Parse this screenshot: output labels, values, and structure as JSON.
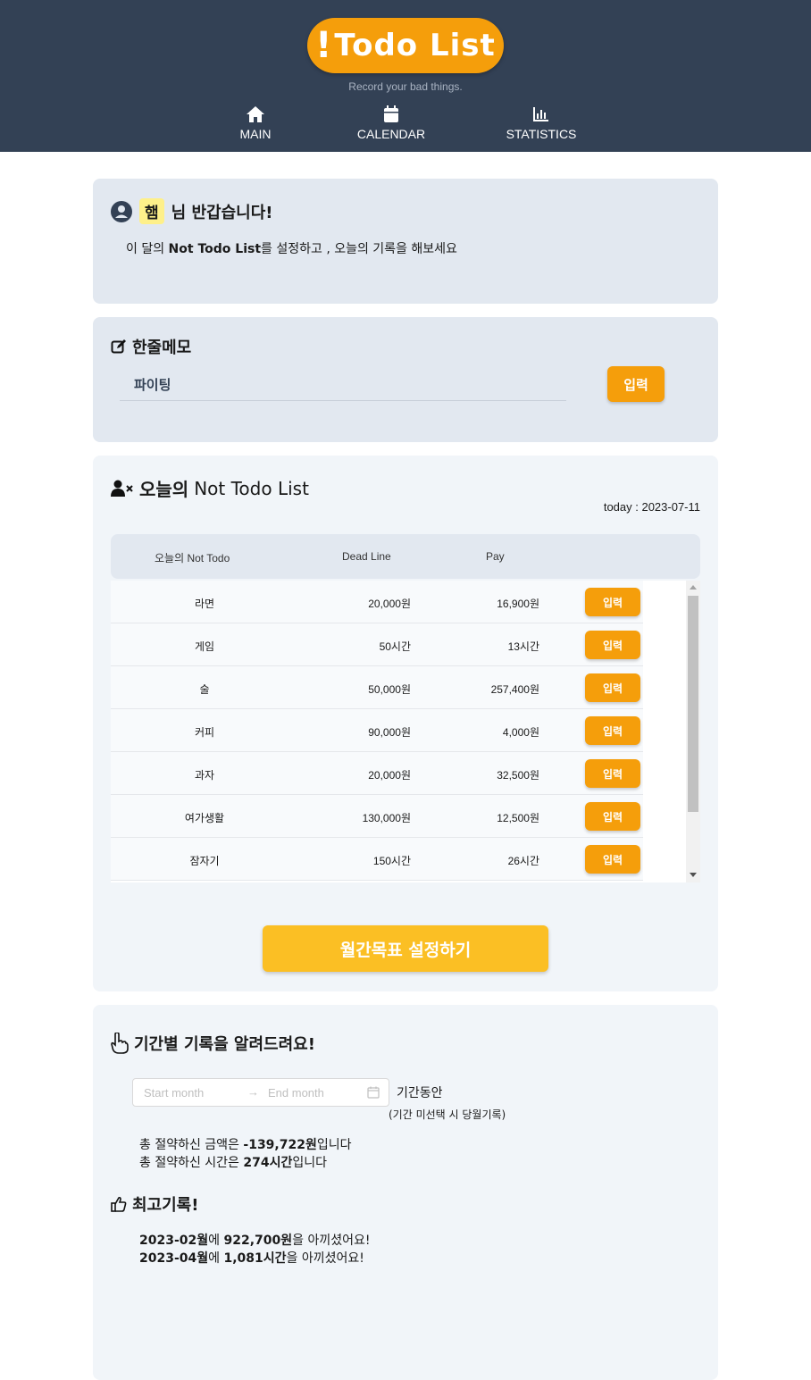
{
  "header": {
    "logo_bang": "!",
    "logo_text": "Todo List",
    "tagline": "Record your bad things.",
    "nav": [
      {
        "label": "MAIN",
        "icon": "home-icon"
      },
      {
        "label": "CALENDAR",
        "icon": "calendar-icon"
      },
      {
        "label": "STATISTICS",
        "icon": "chart-icon"
      }
    ]
  },
  "greeting": {
    "name": "햄",
    "suffix": "님 반갑습니다!",
    "sub_pre": "이 달의 ",
    "sub_bold": "Not Todo List",
    "sub_post": "를 설정하고 , 오늘의 기록을 해보세요"
  },
  "memo": {
    "title": "한줄메모",
    "value": "파이팅",
    "button": "입력"
  },
  "not_todo": {
    "title_pre": "오늘의",
    "title_post": "Not Todo List",
    "today": "today : 2023-07-11",
    "columns": [
      "오늘의 Not Todo",
      "Dead Line",
      "Pay"
    ],
    "rows": [
      {
        "name": "라면",
        "deadline": "20,000원",
        "pay": "16,900원",
        "button": "입력"
      },
      {
        "name": "게임",
        "deadline": "50시간",
        "pay": "13시간",
        "button": "입력"
      },
      {
        "name": "술",
        "deadline": "50,000원",
        "pay": "257,400원",
        "button": "입력"
      },
      {
        "name": "커피",
        "deadline": "90,000원",
        "pay": "4,000원",
        "button": "입력"
      },
      {
        "name": "과자",
        "deadline": "20,000원",
        "pay": "32,500원",
        "button": "입력"
      },
      {
        "name": "여가생활",
        "deadline": "130,000원",
        "pay": "12,500원",
        "button": "입력"
      },
      {
        "name": "잠자기",
        "deadline": "150시간",
        "pay": "26시간",
        "button": "입력"
      }
    ],
    "goal_button": "월간목표 설정하기"
  },
  "period": {
    "title": "기간별 기록을 알려드려요!",
    "start_placeholder": "Start month",
    "end_placeholder": "End month",
    "label": "기간동안",
    "note": "(기간 미선택 시 당월기록)",
    "money_pre": "총 절약하신 금액은 ",
    "money_value": "-139,722원",
    "money_post": "입니다",
    "time_pre": "총 절약하신 시간은 ",
    "time_value": "274시간",
    "time_post": "입니다"
  },
  "best": {
    "title": "최고기록!",
    "money_month": "2023-02월",
    "money_mid": "에 ",
    "money_value": "922,700원",
    "money_post": "을 아끼셨어요!",
    "time_month": "2023-04월",
    "time_mid": "에 ",
    "time_value": "1,081시간",
    "time_post": "을 아끼셨어요!"
  },
  "colors": {
    "header_bg": "#334155",
    "accent": "#f59e0b",
    "goal_button": "#fbbf24",
    "card_dark": "#e2e8f0",
    "card_light": "#f1f5f9"
  }
}
